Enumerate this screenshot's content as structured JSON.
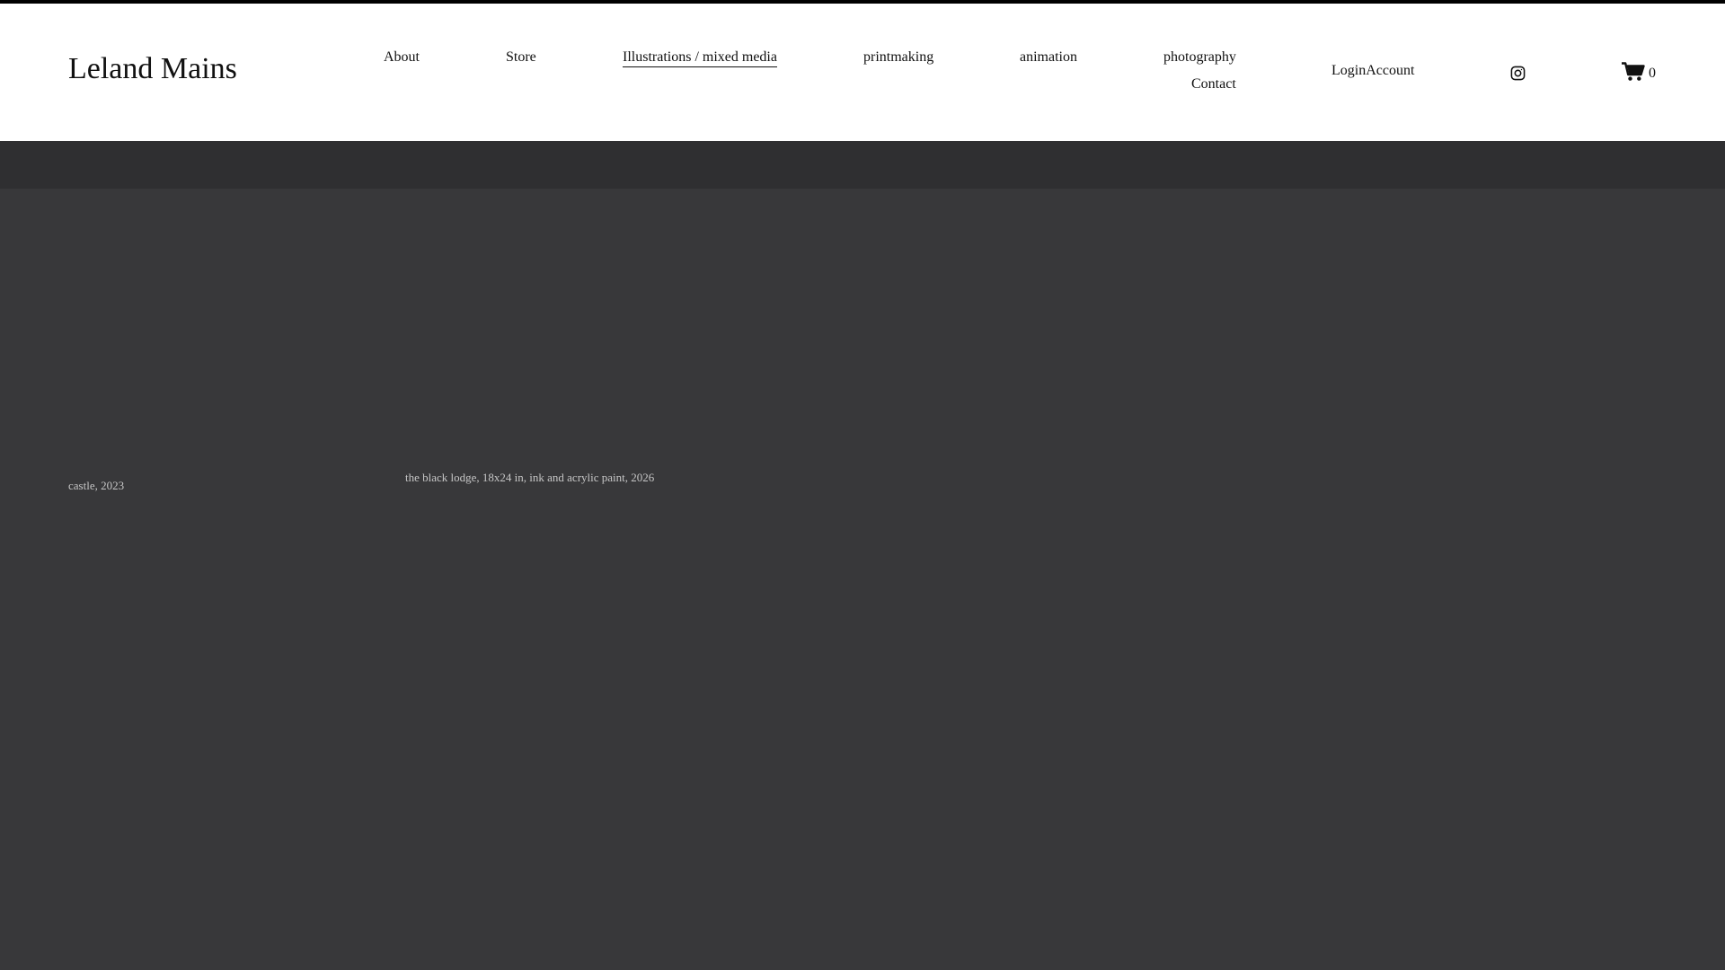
{
  "site": {
    "title": "Leland Mains"
  },
  "nav": {
    "items": [
      {
        "label": "About"
      },
      {
        "label": "Store"
      },
      {
        "label": "Illustrations / mixed media",
        "active": true
      },
      {
        "label": "printmaking"
      },
      {
        "label": "animation"
      },
      {
        "label": "photography"
      },
      {
        "label": "Contact"
      }
    ]
  },
  "account": {
    "label": "LoginAccount"
  },
  "social": {
    "icon": "instagram-icon"
  },
  "cart": {
    "icon": "cart-icon",
    "count": "0"
  },
  "gallery": {
    "captions": [
      {
        "text": "castle, 2023"
      },
      {
        "text": "the black lodge, 18x24 in, ink and acrylic paint, 2026"
      }
    ]
  },
  "colors": {
    "header_bg": "#ffffff",
    "top_stripe": "#000000",
    "band": "#2f2f31",
    "page_bg": "#38383a",
    "caption_text": "#c6c6c6"
  }
}
